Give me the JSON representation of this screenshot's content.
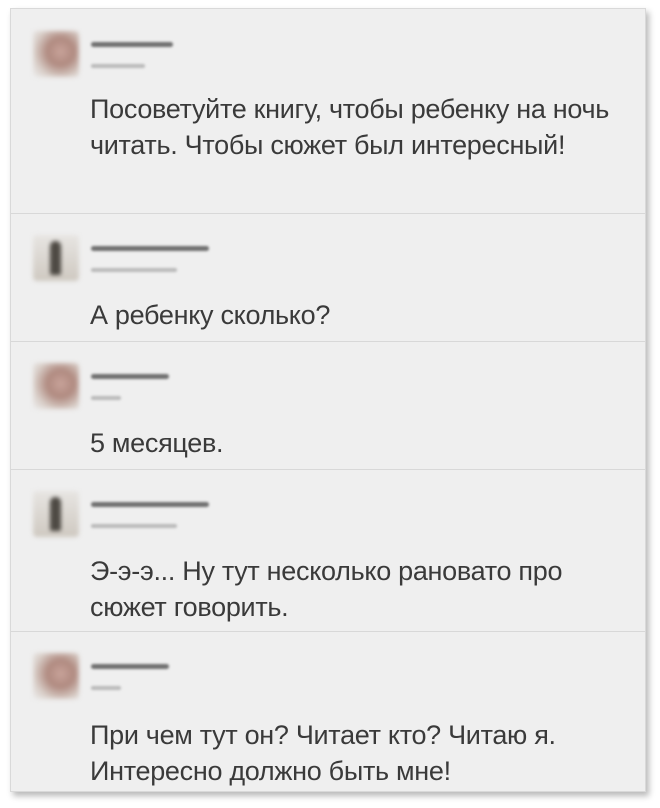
{
  "thread": [
    {
      "avatar_icon": "user-avatar-child-photo",
      "message": "Посоветуйте книгу, чтобы ребенку на ночь читать. Чтобы сюжет был интересный!"
    },
    {
      "avatar_icon": "user-avatar-figure-photo",
      "message": "А ребенку сколько?"
    },
    {
      "avatar_icon": "user-avatar-child-photo",
      "message": "5 месяцев."
    },
    {
      "avatar_icon": "user-avatar-figure-photo",
      "message": "Э-э-э... Ну тут несколько рановато про сюжет говорить."
    },
    {
      "avatar_icon": "user-avatar-child-photo",
      "message": "При чем тут он? Читает кто? Читаю я. Интересно должно быть мне!"
    }
  ]
}
